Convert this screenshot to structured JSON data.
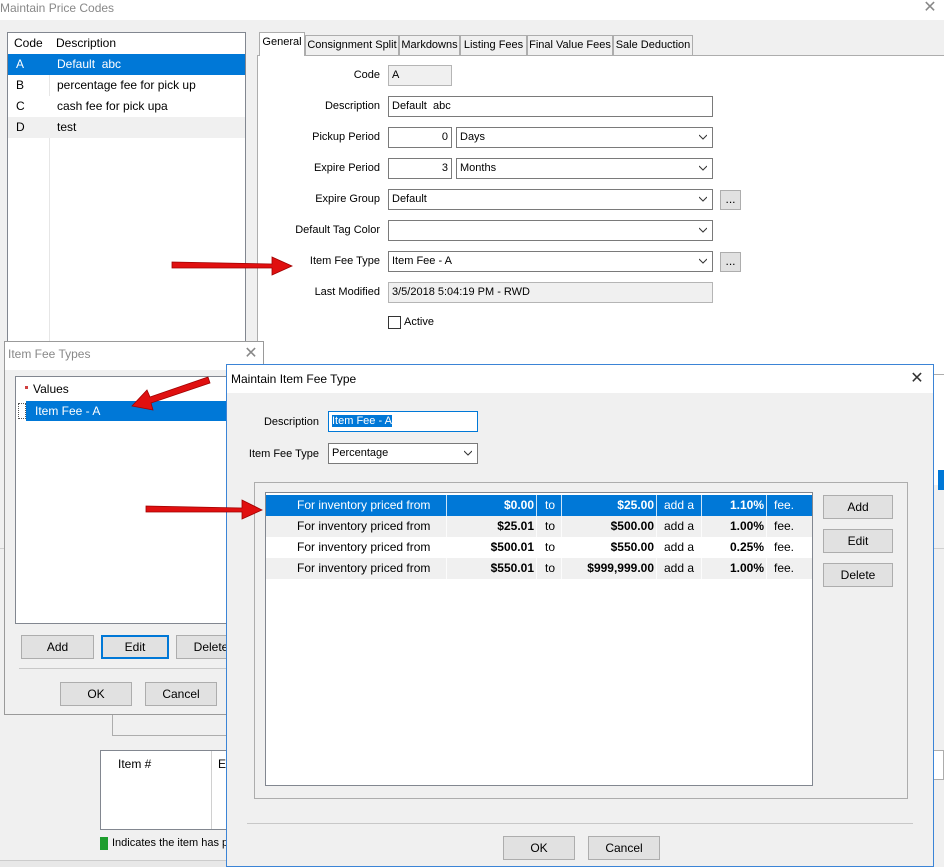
{
  "main": {
    "title": "Maintain Price Codes",
    "list_headers": {
      "code": "Code",
      "description": "Description"
    },
    "codes": [
      {
        "code": "A",
        "description": "Default  abc"
      },
      {
        "code": "B",
        "description": "percentage fee for pick up"
      },
      {
        "code": "C",
        "description": "cash fee for pick upa"
      },
      {
        "code": "D",
        "description": "test"
      }
    ],
    "tabs": [
      "General",
      "Consignment Split",
      "Markdowns",
      "Listing Fees",
      "Final Value Fees",
      "Sale Deduction"
    ],
    "form": {
      "code_label": "Code",
      "code_value": "A",
      "description_label": "Description",
      "description_value": "Default  abc",
      "pickup_label": "Pickup Period",
      "pickup_value": "0",
      "pickup_unit": "Days",
      "expire_label": "Expire Period",
      "expire_value": "3",
      "expire_unit": "Months",
      "expire_group_label": "Expire Group",
      "expire_group_value": "Default",
      "tag_color_label": "Default Tag Color",
      "tag_color_value": "",
      "item_fee_type_label": "Item Fee Type",
      "item_fee_type_value": "Item Fee - A",
      "last_modified_label": "Last Modified",
      "last_modified_value": "3/5/2018 5:04:19 PM - RWD",
      "active_label": "Active",
      "browse_label": "..."
    },
    "bottom": {
      "item_header": "Item #",
      "e_header": "E",
      "legend_text": "Indicates the item has p",
      "legend_color": "#1e9e2e"
    }
  },
  "item_fee_types": {
    "title": "Item Fee Types",
    "values_header": "Values",
    "items": [
      "Item Fee - A"
    ],
    "add_label": "Add",
    "edit_label": "Edit",
    "delete_label": "Delete",
    "ok_label": "OK",
    "cancel_label": "Cancel"
  },
  "maintain_fee": {
    "title": "Maintain Item Fee Type",
    "description_label": "Description",
    "description_value": "Item Fee - A",
    "type_label": "Item Fee Type",
    "type_value": "Percentage",
    "rows": [
      {
        "text": "For inventory priced from",
        "from": "$0.00",
        "to": "to",
        "upto": "$25.00",
        "add": "add a",
        "pct": "1.10%",
        "fee": "fee."
      },
      {
        "text": "For inventory priced from",
        "from": "$25.01",
        "to": "to",
        "upto": "$500.00",
        "add": "add a",
        "pct": "1.00%",
        "fee": "fee."
      },
      {
        "text": "For inventory priced from",
        "from": "$500.01",
        "to": "to",
        "upto": "$550.00",
        "add": "add a",
        "pct": "0.25%",
        "fee": "fee."
      },
      {
        "text": "For inventory priced from",
        "from": "$550.01",
        "to": "to",
        "upto": "$999,999.00",
        "add": "add a",
        "pct": "1.00%",
        "fee": "fee."
      }
    ],
    "add_label": "Add",
    "edit_label": "Edit",
    "delete_label": "Delete",
    "ok_label": "OK",
    "cancel_label": "Cancel"
  },
  "colors": {
    "selection": "#0078d7",
    "arrow": "#e01010"
  }
}
